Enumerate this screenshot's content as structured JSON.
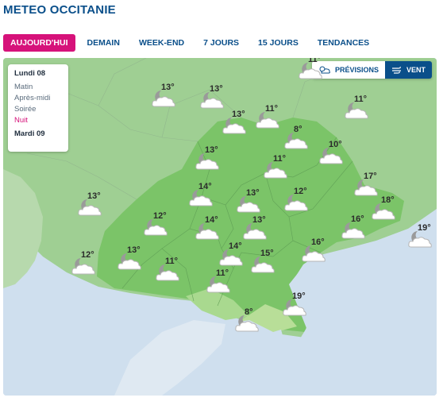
{
  "header": {
    "title": "METEO OCCITANIE"
  },
  "tabs": [
    {
      "label": "AUJOURD'HUI",
      "active": true
    },
    {
      "label": "DEMAIN",
      "active": false
    },
    {
      "label": "WEEK-END",
      "active": false
    },
    {
      "label": "7 JOURS",
      "active": false
    },
    {
      "label": "15 JOURS",
      "active": false
    },
    {
      "label": "TENDANCES",
      "active": false
    }
  ],
  "time_panel": {
    "day": "Lundi 08",
    "slots": [
      "Matin",
      "Après-midi",
      "Soirée",
      "Nuit"
    ],
    "active_slot": "Nuit",
    "next_day": "Mardi 09"
  },
  "view_toggle": {
    "forecast_label": "PRÉVISIONS",
    "wind_label": "VENT",
    "selected": "VENT"
  },
  "colors": {
    "brand": "#0a4f8a",
    "accent": "#d6127a",
    "region": "#7bc468",
    "outside_land": "#9fcf93",
    "sea": "#cfdfee"
  },
  "map": {
    "icon": "moon-cloud-icon",
    "temperatures": [
      "11°",
      "13°",
      "13°",
      "13°",
      "11°",
      "11°",
      "8°",
      "10°",
      "13°",
      "11°",
      "14°",
      "13°",
      "12°",
      "17°",
      "13°",
      "12°",
      "14°",
      "13°",
      "18°",
      "16°",
      "19°",
      "12°",
      "13°",
      "11°",
      "14°",
      "15°",
      "16°",
      "11°",
      "19°",
      "8°"
    ]
  }
}
